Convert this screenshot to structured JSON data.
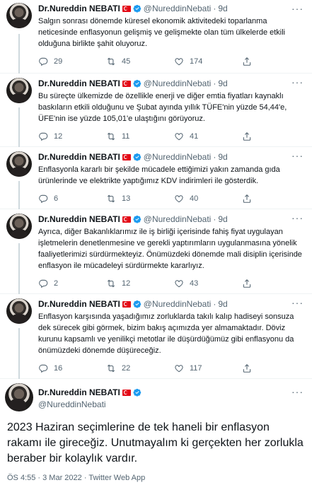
{
  "author": {
    "name": "Dr.Nureddin NEBATI",
    "handle": "@NureddinNebati"
  },
  "replies": [
    {
      "time": "9d",
      "text": "Salgın sonrası dönemde küresel ekonomik aktivitedeki toparlanma neticesinde enflasyonun gelişmiş ve gelişmekte olan tüm ülkelerde etkili olduğuna birlikte şahit oluyoruz.",
      "replies": "29",
      "retweets": "45",
      "likes": "174"
    },
    {
      "time": "9d",
      "text": "Bu süreçte ülkemizde de özellikle enerji ve diğer emtia fiyatları kaynaklı baskıların etkili olduğunu ve Şubat ayında yıllık TÜFE'nin yüzde 54,44'e, ÜFE'nin ise yüzde 105,01'e ulaştığını görüyoruz.",
      "replies": "12",
      "retweets": "11",
      "likes": "41"
    },
    {
      "time": "9d",
      "text": "Enflasyonla kararlı bir şekilde mücadele ettiğimizi yakın zamanda gıda ürünlerinde ve elektrikte yaptığımız KDV indirimleri ile gösterdik.",
      "replies": "6",
      "retweets": "13",
      "likes": "40"
    },
    {
      "time": "9d",
      "text": "Ayrıca, diğer Bakanlıklarımız ile iş birliği içerisinde fahiş fiyat uygulayan işletmelerin denetlenmesine ve gerekli yaptırımların uygulanmasına yönelik faaliyetlerimizi sürdürmekteyiz. Önümüzdeki dönemde mali disiplin içerisinde enflasyon ile mücadeleyi sürdürmekte kararlıyız.",
      "replies": "2",
      "retweets": "12",
      "likes": "43"
    },
    {
      "time": "9d",
      "text": "Enflasyon karşısında yaşadığımız zorluklarda takılı kalıp hadiseyi sonsuza dek sürecek gibi görmek, bizim bakış açımızda yer almamaktadır. Döviz kurunu kapsamlı ve yenilikçi metotlar ile düşürdüğümüz gibi enflasyonu da önümüzdeki dönemde düşüreceğiz.",
      "replies": "16",
      "retweets": "22",
      "likes": "117"
    }
  ],
  "main_tweet": {
    "text": "2023 Haziran seçimlerine de tek haneli bir enflasyon rakamı ile gireceğiz. Unutmayalım ki gerçekten her zorlukla beraber bir kolaylık vardır.",
    "meta": "ÖS 4:55 · 3 Mar 2022 · Twitter Web App"
  },
  "labels": {
    "dot": "·",
    "more": "···"
  },
  "colors": {
    "text": "#0f1419",
    "secondary": "#536471",
    "verified": "#1d9bf0",
    "flag": "#e30a17",
    "thread_line": "#cfd9de"
  },
  "icons": [
    "avatar",
    "turkey-flag-icon",
    "verified-badge-icon",
    "reply-icon",
    "retweet-icon",
    "like-icon",
    "share-icon",
    "more-icon"
  ]
}
